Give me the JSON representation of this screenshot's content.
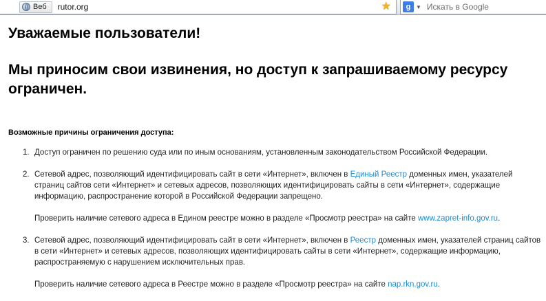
{
  "browser": {
    "identity_label": "Веб",
    "url": "rutor.org",
    "search_engine": "g-logo-icon",
    "search_placeholder": "Искать в Google"
  },
  "page": {
    "greeting": "Уважаемые пользователи!",
    "apology": "Мы приносим свои извинения, но доступ к запрашиваемому ресурсу ограничен.",
    "reasons_title": "Возможные причины ограничения доступа:",
    "reasons": [
      {
        "num": "1.",
        "text": "Доступ ограничен  по решению суда или по иным основаниям, установленным законодательством Российской Федерации."
      },
      {
        "num": "2.",
        "text_before": "Сетевой адрес, позволяющий идентифицировать сайт в сети «Интернет», включен в ",
        "link": "Единый Реестр",
        "text_after": " доменных имен, указателей страниц сайтов сети «Интернет» и сетевых адресов, позволяющих идентифицировать сайты в сети «Интернет», содержащие информацию, распространение которой в Российской Федерации запрещено.",
        "check_text": "Проверить наличие сетевого адреса в Едином реестре можно в разделе «Просмотр реестра» на сайте ",
        "check_link": "www.zapret-info.gov.ru",
        "check_end": "."
      },
      {
        "num": "3.",
        "text_before": "Сетевой адрес, позволяющий идентифицировать сайт в сети «Интернет», включен в ",
        "link": "Реестр",
        "text_after": " доменных имен, указателей страниц сайтов в сети «Интернет» и сетевых адресов, позволяющих идентифицировать сайты в сети «Интернет», содержащие информацию, распространяемую с нарушением исключительных прав.",
        "check_text": "Проверить наличие сетевого адреса в Реестре можно в разделе «Просмотр реестра» на сайте ",
        "check_link": "nap.rkn.gov.ru",
        "check_end": "."
      }
    ]
  },
  "colors": {
    "link": "#1e8bd1",
    "star": "#f2b21e"
  }
}
